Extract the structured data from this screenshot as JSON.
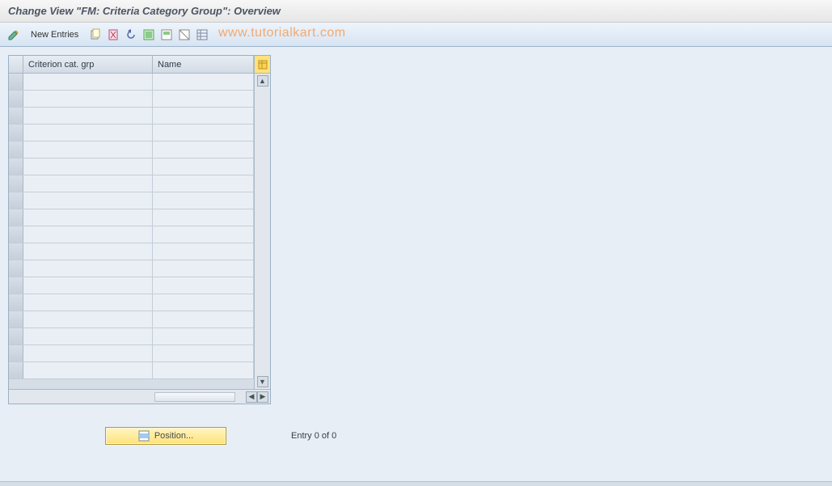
{
  "title": "Change View \"FM: Criteria Category Group\": Overview",
  "toolbar": {
    "new_entries_label": "New Entries"
  },
  "watermark": "www.tutorialkart.com",
  "table": {
    "columns": {
      "col1": "Criterion cat. grp",
      "col2": "Name"
    },
    "row_count": 18
  },
  "footer": {
    "position_label": "Position...",
    "entry_text": "Entry 0 of 0"
  }
}
